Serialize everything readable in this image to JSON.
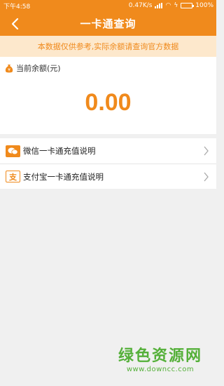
{
  "status_bar": {
    "time": "下午4:58",
    "network_speed": "0.47K/s",
    "battery_percent": "100%"
  },
  "app_bar": {
    "title": "一卡通查询",
    "back_icon": "chevron-left-icon"
  },
  "notice": {
    "text": "本数据仅供参考,实际余额请查询官方数据"
  },
  "balance": {
    "label": "当前余额(元)",
    "value": "0.00",
    "icon": "money-bag-icon"
  },
  "list": {
    "items": [
      {
        "label": "微信一卡通充值说明",
        "icon": "wechat-pay-icon"
      },
      {
        "label": "支付宝一卡通充值说明",
        "icon": "alipay-icon"
      }
    ]
  },
  "watermark": {
    "title": "绿色资源网",
    "url": "www.downcc.com"
  },
  "colors": {
    "accent": "#f08a1c",
    "notice_bg": "#fde8cc",
    "page_bg": "#f0f0f0",
    "watermark": "#55b03a"
  }
}
